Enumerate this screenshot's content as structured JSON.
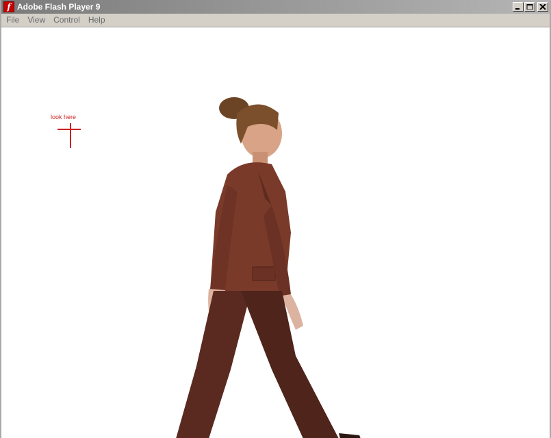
{
  "window": {
    "title": "Adobe Flash Player 9",
    "icon": "flash-player-icon"
  },
  "menu": {
    "items": [
      "File",
      "View",
      "Control",
      "Help"
    ]
  },
  "stage": {
    "annotation_text": "look here",
    "marker_color": "#cc2222",
    "figure": "walking-woman-in-brown-suit"
  }
}
